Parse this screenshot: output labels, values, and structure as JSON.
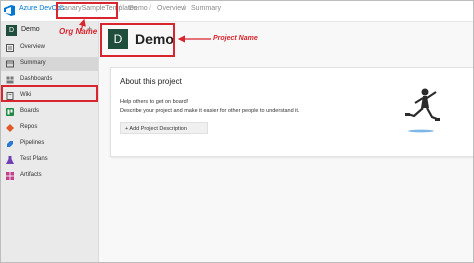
{
  "topbar": {
    "brand": "Azure DevOps",
    "org": "CanarySampleTemplates",
    "breadcrumbs": [
      "Demo",
      "Overview",
      "Summary"
    ],
    "separator": "/"
  },
  "sidebar": {
    "project_badge": "D",
    "project_name": "Demo",
    "add_symbol": "+",
    "items": [
      {
        "label": "Overview",
        "icon": "overview-icon",
        "color": "#555555"
      },
      {
        "label": "Summary",
        "icon": "summary-icon",
        "color": "#555555"
      },
      {
        "label": "Dashboards",
        "icon": "dashboards-icon",
        "color": "#555555"
      },
      {
        "label": "Wiki",
        "icon": "wiki-icon",
        "color": "#555555"
      },
      {
        "label": "Boards",
        "icon": "boards-icon",
        "color": "#1e8a44"
      },
      {
        "label": "Repos",
        "icon": "repos-icon",
        "color": "#e05a2b"
      },
      {
        "label": "Pipelines",
        "icon": "pipelines-icon",
        "color": "#2a7ad4"
      },
      {
        "label": "Test Plans",
        "icon": "test-plans-icon",
        "color": "#6f3fb5"
      },
      {
        "label": "Artifacts",
        "icon": "artifacts-icon",
        "color": "#c63e8f"
      }
    ]
  },
  "main": {
    "project_badge": "D",
    "project_title": "Demo",
    "about": {
      "title": "About this project",
      "help_heading": "Help others to get on board!",
      "help_text": "Describe your project and make it easier for other people to understand it.",
      "add_button": "+  Add Project Description"
    }
  },
  "annotations": {
    "org_label": "Org Name",
    "project_label": "Project Name",
    "color": "#d9262e"
  }
}
